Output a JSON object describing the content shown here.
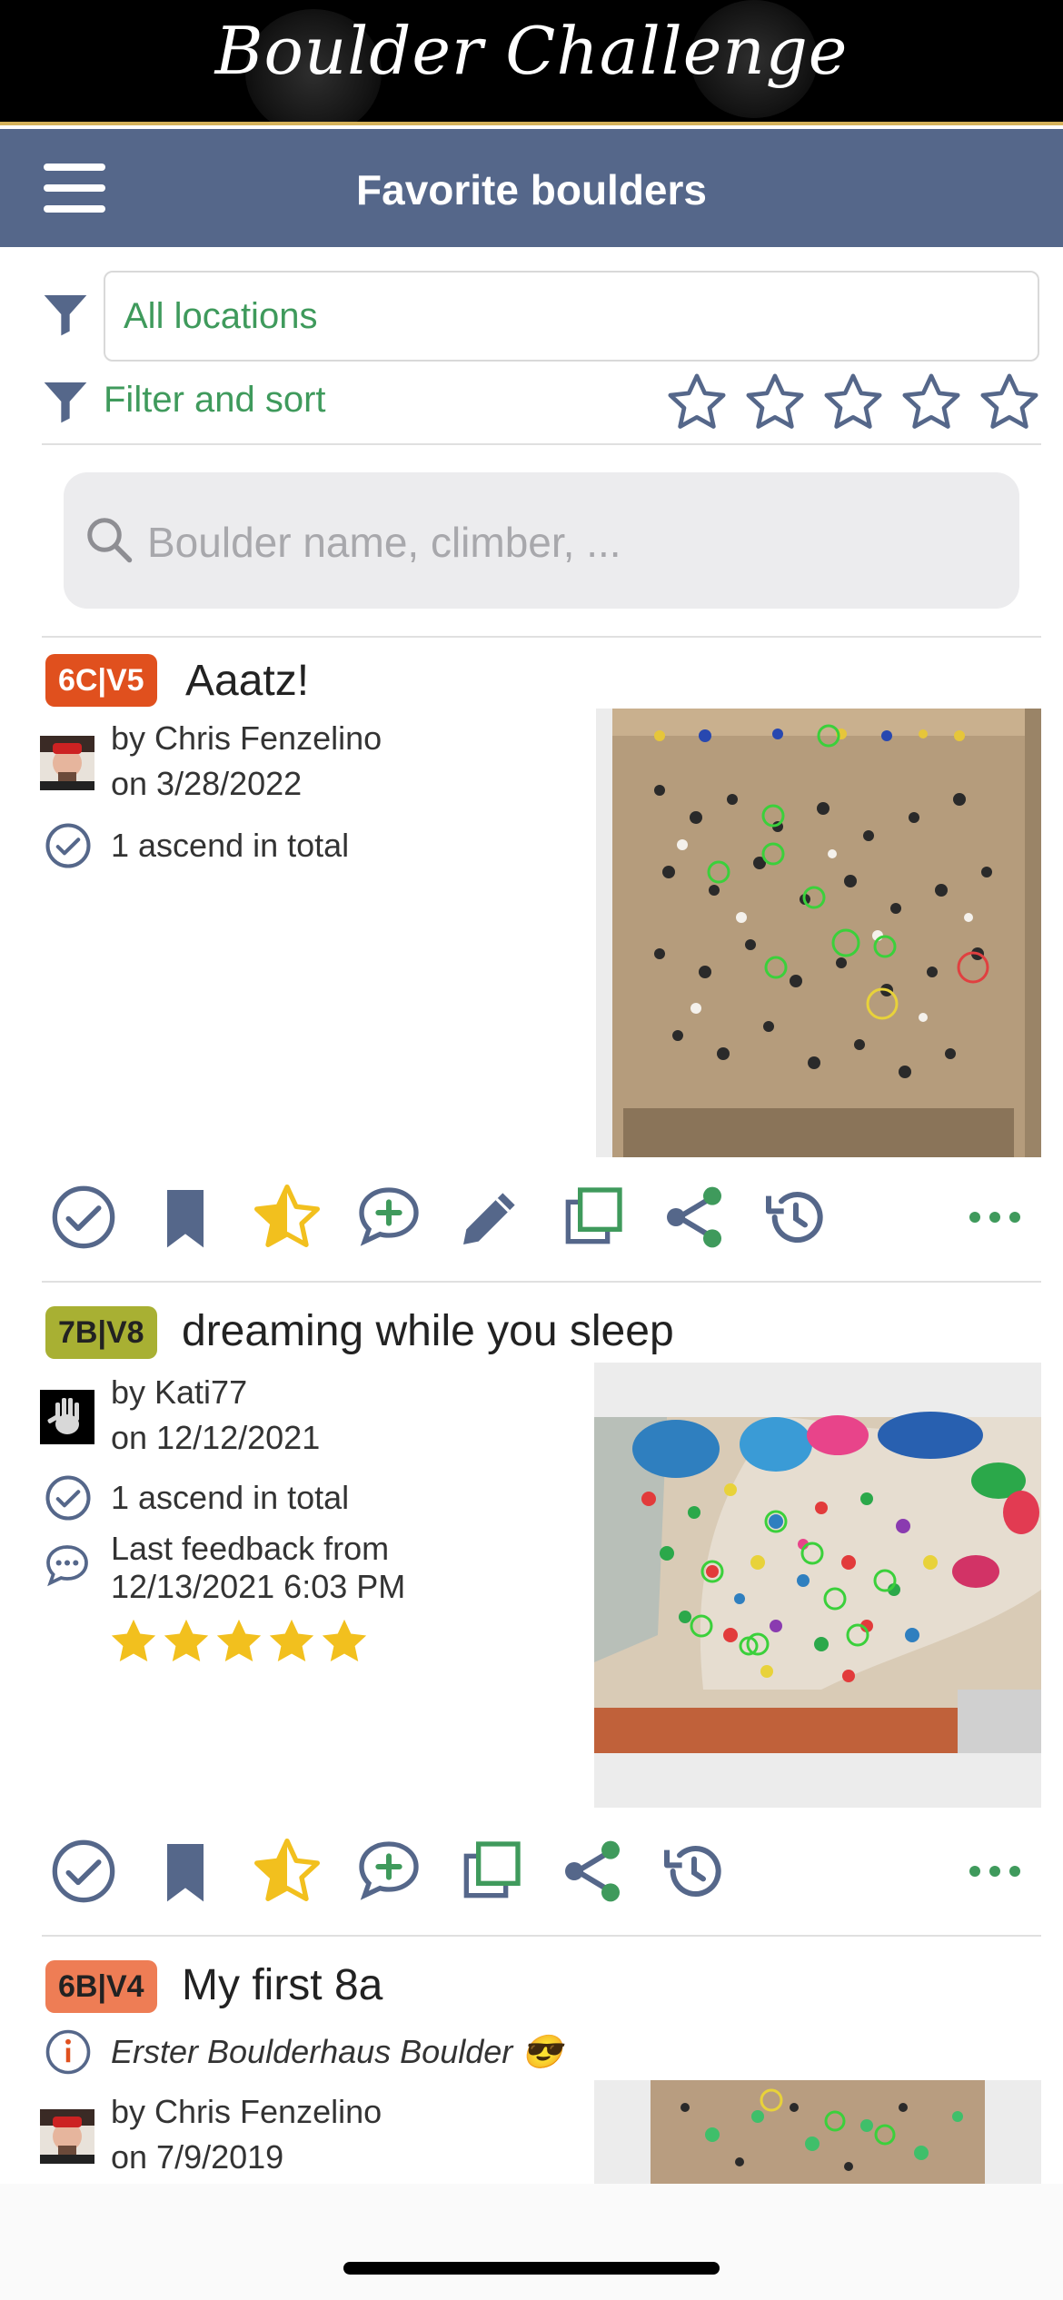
{
  "brand": {
    "logo_text": "Boulder Challenge"
  },
  "navbar": {
    "title": "Favorite boulders"
  },
  "filters": {
    "location_value": "All locations",
    "filter_sort_label": "Filter and sort",
    "rating_stars": 5
  },
  "search": {
    "placeholder": "Boulder name, climber, ..."
  },
  "boulders": [
    {
      "grade": "6C|V5",
      "grade_color": "#e0501e",
      "name": "Aaatz!",
      "by": "by Chris Fenzelino",
      "date": "on 3/28/2022",
      "ascends": "1 ascend in total"
    },
    {
      "grade": "7B|V8",
      "grade_color": "#a8b033",
      "name": "dreaming while you sleep",
      "by": "by Kati77",
      "date": "on 12/12/2021",
      "ascends": "1 ascend in total",
      "feedback_line1": "Last feedback from",
      "feedback_line2": "12/13/2021 6:03 PM",
      "rating": 5
    },
    {
      "grade": "6B|V4",
      "grade_color": "#ee7d55",
      "name": "My first 8a",
      "info": "Erster Boulderhaus Boulder 😎",
      "by": "by Chris Fenzelino",
      "date": "on 7/9/2019"
    }
  ],
  "colors": {
    "nav": "#55678a",
    "accent_green": "#3f9a5c",
    "icon_navy": "#55678a",
    "star_gold": "#f2c01e"
  }
}
